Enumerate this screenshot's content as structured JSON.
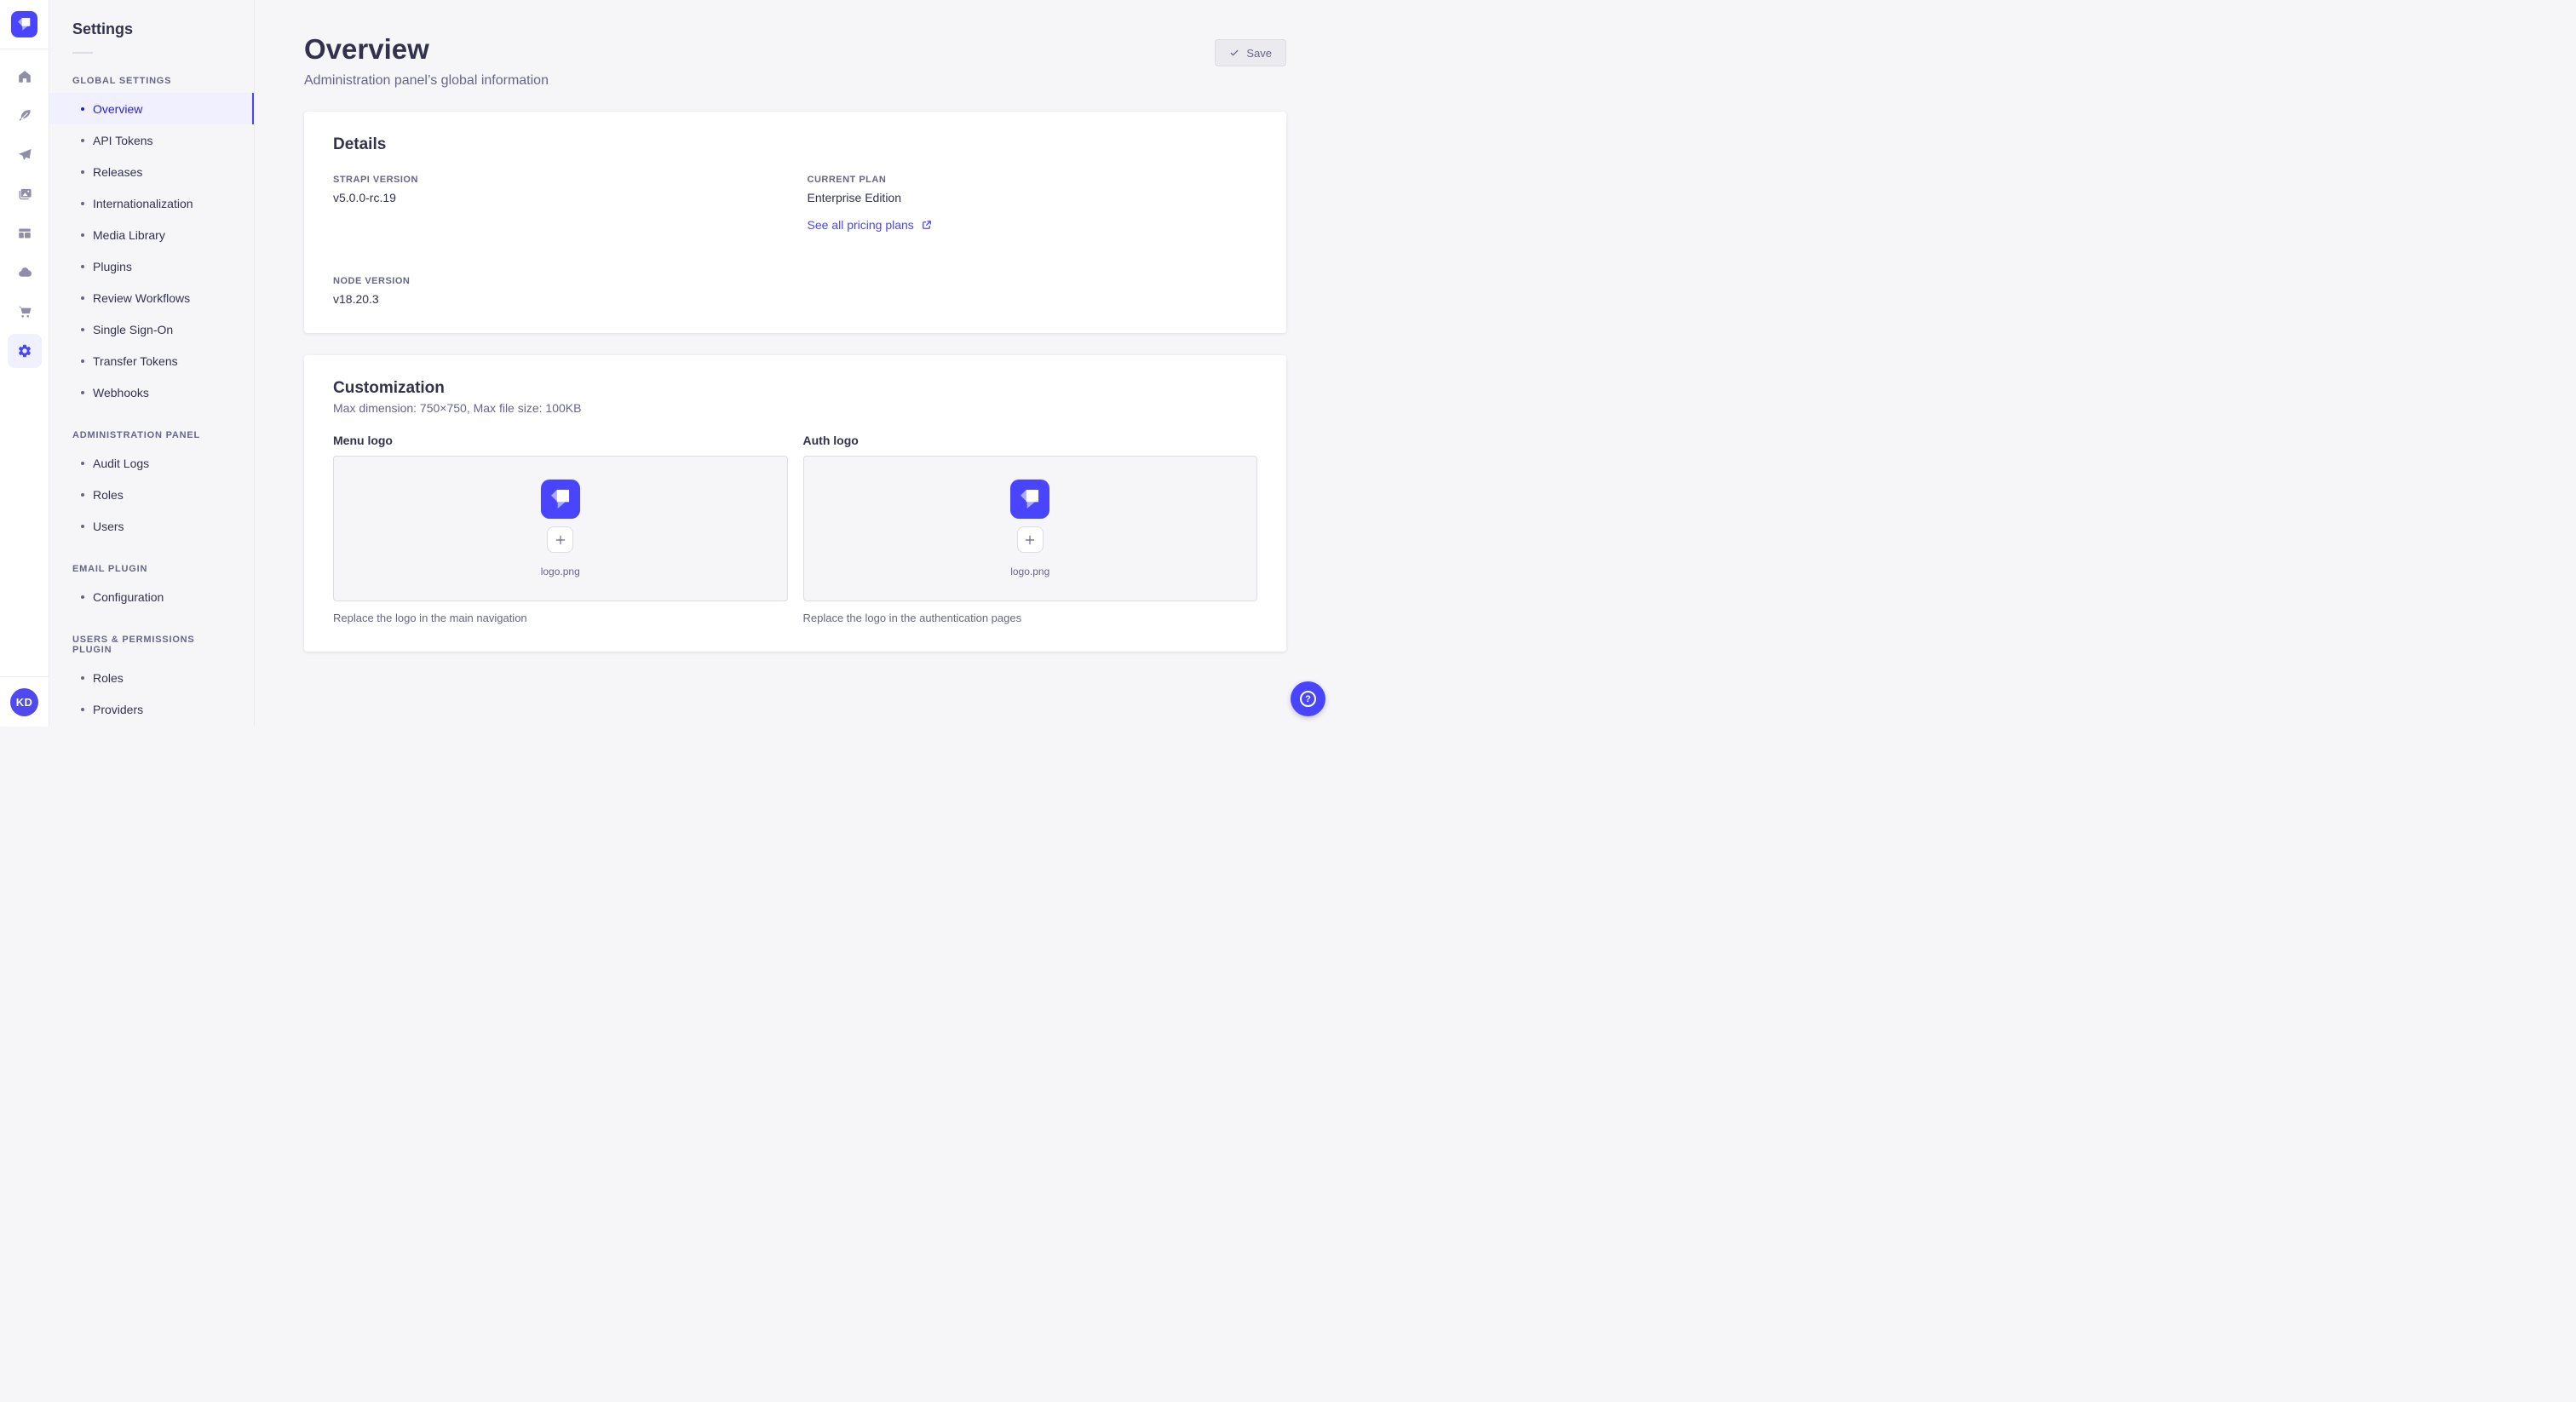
{
  "colors": {
    "primary": "#4945ff",
    "primary_light_bg": "#f0f0ff",
    "active_text": "#271fe0",
    "page_bg": "#f6f6f9",
    "border": "#eaeaef",
    "muted_text": "#666687",
    "dark_text": "#32324d"
  },
  "rail": {
    "avatar_initials": "KD"
  },
  "sidebar": {
    "title": "Settings",
    "sections": [
      {
        "label": "GLOBAL SETTINGS",
        "items": [
          {
            "label": "Overview",
            "active": true
          },
          {
            "label": "API Tokens"
          },
          {
            "label": "Releases"
          },
          {
            "label": "Internationalization"
          },
          {
            "label": "Media Library"
          },
          {
            "label": "Plugins"
          },
          {
            "label": "Review Workflows"
          },
          {
            "label": "Single Sign-On"
          },
          {
            "label": "Transfer Tokens"
          },
          {
            "label": "Webhooks"
          }
        ]
      },
      {
        "label": "ADMINISTRATION PANEL",
        "items": [
          {
            "label": "Audit Logs"
          },
          {
            "label": "Roles"
          },
          {
            "label": "Users"
          }
        ]
      },
      {
        "label": "EMAIL PLUGIN",
        "items": [
          {
            "label": "Configuration"
          }
        ]
      },
      {
        "label": "USERS & PERMISSIONS PLUGIN",
        "items": [
          {
            "label": "Roles"
          },
          {
            "label": "Providers"
          }
        ]
      }
    ]
  },
  "header": {
    "title": "Overview",
    "subtitle": "Administration panel’s global information",
    "save_label": "Save"
  },
  "details": {
    "title": "Details",
    "strapi_version": {
      "label": "STRAPI VERSION",
      "value": "v5.0.0-rc.19"
    },
    "current_plan": {
      "label": "CURRENT PLAN",
      "value": "Enterprise Edition"
    },
    "node_version": {
      "label": "NODE VERSION",
      "value": "v18.20.3"
    },
    "pricing_link_label": "See all pricing plans"
  },
  "customization": {
    "title": "Customization",
    "subtitle": "Max dimension: 750×750, Max file size: 100KB",
    "uploads": [
      {
        "label": "Menu logo",
        "filename": "logo.png",
        "hint": "Replace the logo in the main navigation"
      },
      {
        "label": "Auth logo",
        "filename": "logo.png",
        "hint": "Replace the logo in the authentication pages"
      }
    ]
  },
  "help": {
    "label": "?"
  }
}
